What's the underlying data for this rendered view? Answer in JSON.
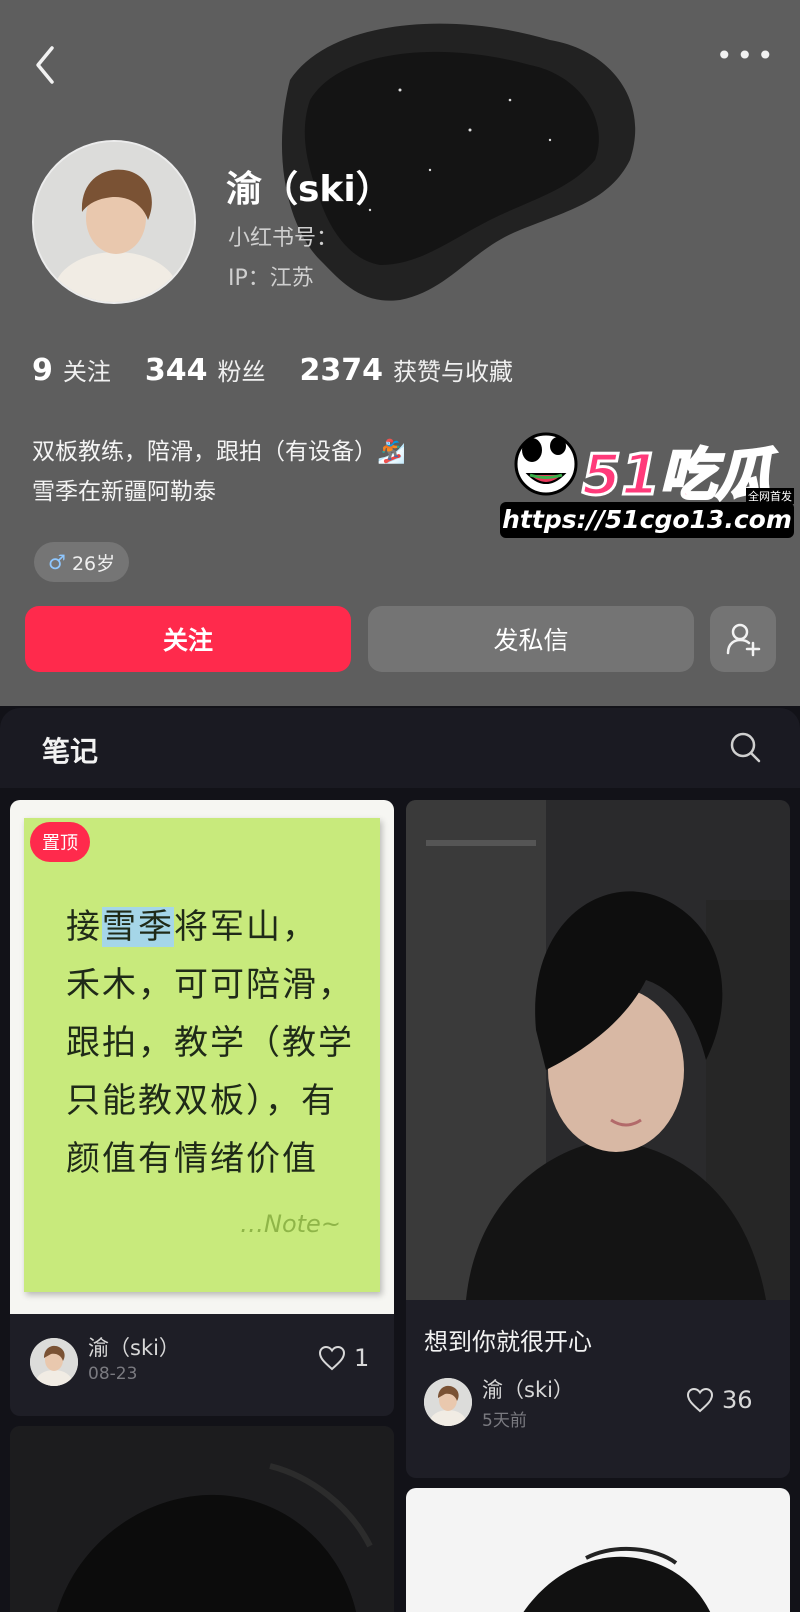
{
  "profile": {
    "name": "渝（ski）",
    "red_id_label": "小红书号：",
    "ip": "IP：江苏",
    "stats": [
      {
        "num": "9",
        "label": "关注"
      },
      {
        "num": "344",
        "label": "粉丝"
      },
      {
        "num": "2374",
        "label": "获赞与收藏"
      }
    ],
    "bio_line1": "双板教练，陪滑，跟拍（有设备）🏂",
    "bio_line2": "雪季在新疆阿勒泰",
    "age": "26岁",
    "age_symbol": "♂"
  },
  "actions": {
    "follow": "关注",
    "message": "发私信"
  },
  "watermark": {
    "brand": "51吃瓜",
    "tag": "全网首发",
    "url": "https://51cgo13.com"
  },
  "notes_tab": {
    "label": "笔记"
  },
  "cards": [
    {
      "pinned_label": "置顶",
      "sticky_lines": [
        "接雪季将军山，",
        "禾木，可可陪滑，",
        "跟拍，教学（教学",
        "只能教双板），有",
        "颜值有情绪价值"
      ],
      "sticky_highlight": "雪季",
      "sticky_sign": "…Note~",
      "author": "渝（ski）",
      "time": "08-23",
      "likes": "1"
    },
    {
      "title": "想到你就很开心",
      "author": "渝（ski）",
      "time": "5天前",
      "likes": "36"
    }
  ],
  "icons": {
    "back": "back-arrow-icon",
    "more": "more-dots-icon",
    "add_friend": "add-user-icon",
    "search": "search-icon",
    "heart": "heart-icon"
  },
  "colors": {
    "accent": "#ff2a4c",
    "header_bg": "#5e5e5e",
    "dark_bg": "#121218"
  }
}
